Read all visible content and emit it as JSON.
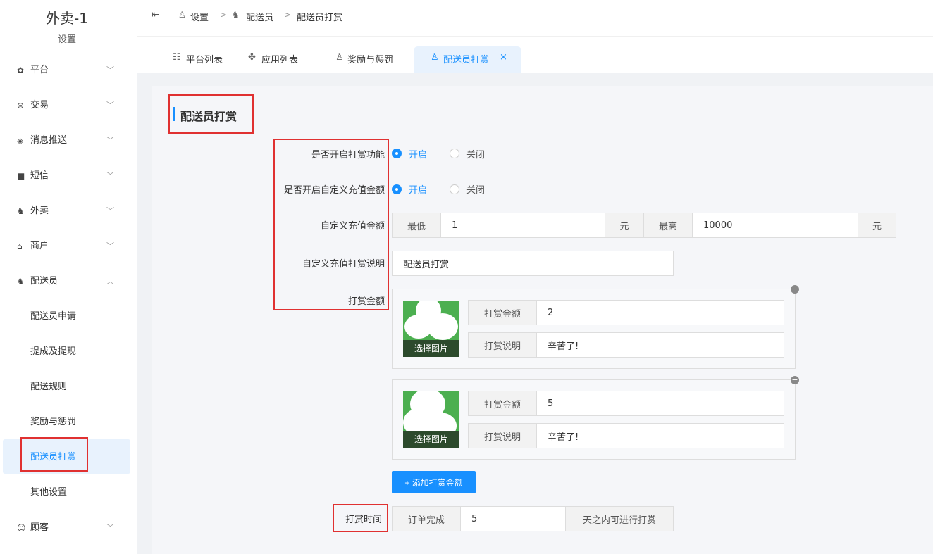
{
  "sidebar": {
    "title": "外卖-1",
    "subtitle": "设置",
    "items": [
      {
        "icon": "gear-icon",
        "label": "平台"
      },
      {
        "icon": "coin-icon",
        "label": "交易"
      },
      {
        "icon": "bell-off-icon",
        "label": "消息推送"
      },
      {
        "icon": "message-icon",
        "label": "短信"
      },
      {
        "icon": "scooter-icon",
        "label": "外卖"
      },
      {
        "icon": "store-icon",
        "label": "商户"
      },
      {
        "icon": "scooter-icon",
        "label": "配送员"
      }
    ],
    "sub_items": [
      "配送员申请",
      "提成及提现",
      "配送规则",
      "奖励与惩罚",
      "配送员打赏",
      "其他设置"
    ],
    "bottom_item": {
      "icon": "user-circle-icon",
      "label": "顾客"
    }
  },
  "breadcrumb": [
    "设置",
    "配送员",
    "配送员打赏"
  ],
  "tabs": [
    {
      "label": "平台列表"
    },
    {
      "label": "应用列表"
    },
    {
      "label": "奖励与惩罚"
    },
    {
      "label": "配送员打赏",
      "close": "×"
    }
  ],
  "section_title": "配送员打赏",
  "form": {
    "enable_tip": {
      "label": "是否开启打赏功能",
      "on": "开启",
      "off": "关闭",
      "selected": "开启"
    },
    "enable_custom": {
      "label": "是否开启自定义充值金额",
      "on": "开启",
      "off": "关闭",
      "selected": "开启"
    },
    "custom_amount": {
      "label": "自定义充值金额",
      "min_label": "最低",
      "min_value": "1",
      "unit": "元",
      "max_label": "最高",
      "max_value": "10000"
    },
    "custom_note": {
      "label": "自定义充值打赏说明",
      "value": "配送员打赏"
    },
    "amounts_label": "打赏金额",
    "amounts": [
      {
        "pic_label": "选择图片",
        "amount_label": "打赏金额",
        "amount": "2",
        "note_label": "打赏说明",
        "note": "辛苦了!"
      },
      {
        "pic_label": "选择图片",
        "amount_label": "打赏金额",
        "amount": "5",
        "note_label": "打赏说明",
        "note": "辛苦了!"
      }
    ],
    "add_button": "+ 添加打赏金额",
    "tip_time": {
      "label": "打赏时间",
      "prefix": "订单完成",
      "value": "5",
      "suffix": "天之内可进行打赏"
    }
  },
  "colors": {
    "accent": "#1890ff",
    "highlight": "#e03131"
  }
}
